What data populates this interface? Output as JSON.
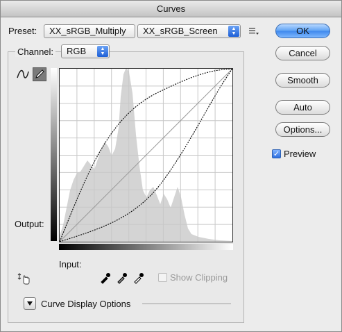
{
  "window": {
    "title": "Curves"
  },
  "preset": {
    "label": "Preset:",
    "left_value": "XX_sRGB_Multiply",
    "right_value": "XX_sRGB_Screen",
    "menu_icon": "preset-options-icon"
  },
  "channel": {
    "label": "Channel:",
    "value": "RGB"
  },
  "buttons": {
    "ok": "OK",
    "cancel": "Cancel",
    "smooth": "Smooth",
    "auto": "Auto",
    "options": "Options..."
  },
  "preview": {
    "label": "Preview",
    "checked": true
  },
  "graph": {
    "output_label": "Output:",
    "input_label": "Input:",
    "show_clipping_label": "Show Clipping",
    "show_clipping_checked": false
  },
  "curve_display": {
    "label": "Curve Display Options"
  },
  "tools": {
    "curve_tool_icon": "curve-point-icon",
    "pencil_tool_icon": "pencil-icon",
    "hand_tool_icon": "on-image-adjust-icon",
    "black_eyedropper_icon": "black-eyedropper-icon",
    "gray_eyedropper_icon": "gray-eyedropper-icon",
    "white_eyedropper_icon": "white-eyedropper-icon"
  },
  "colors": {
    "accent": "#3d87ec",
    "histogram": "#d4d4d4",
    "grid": "#c8c8c8",
    "curve": "#111111"
  }
}
